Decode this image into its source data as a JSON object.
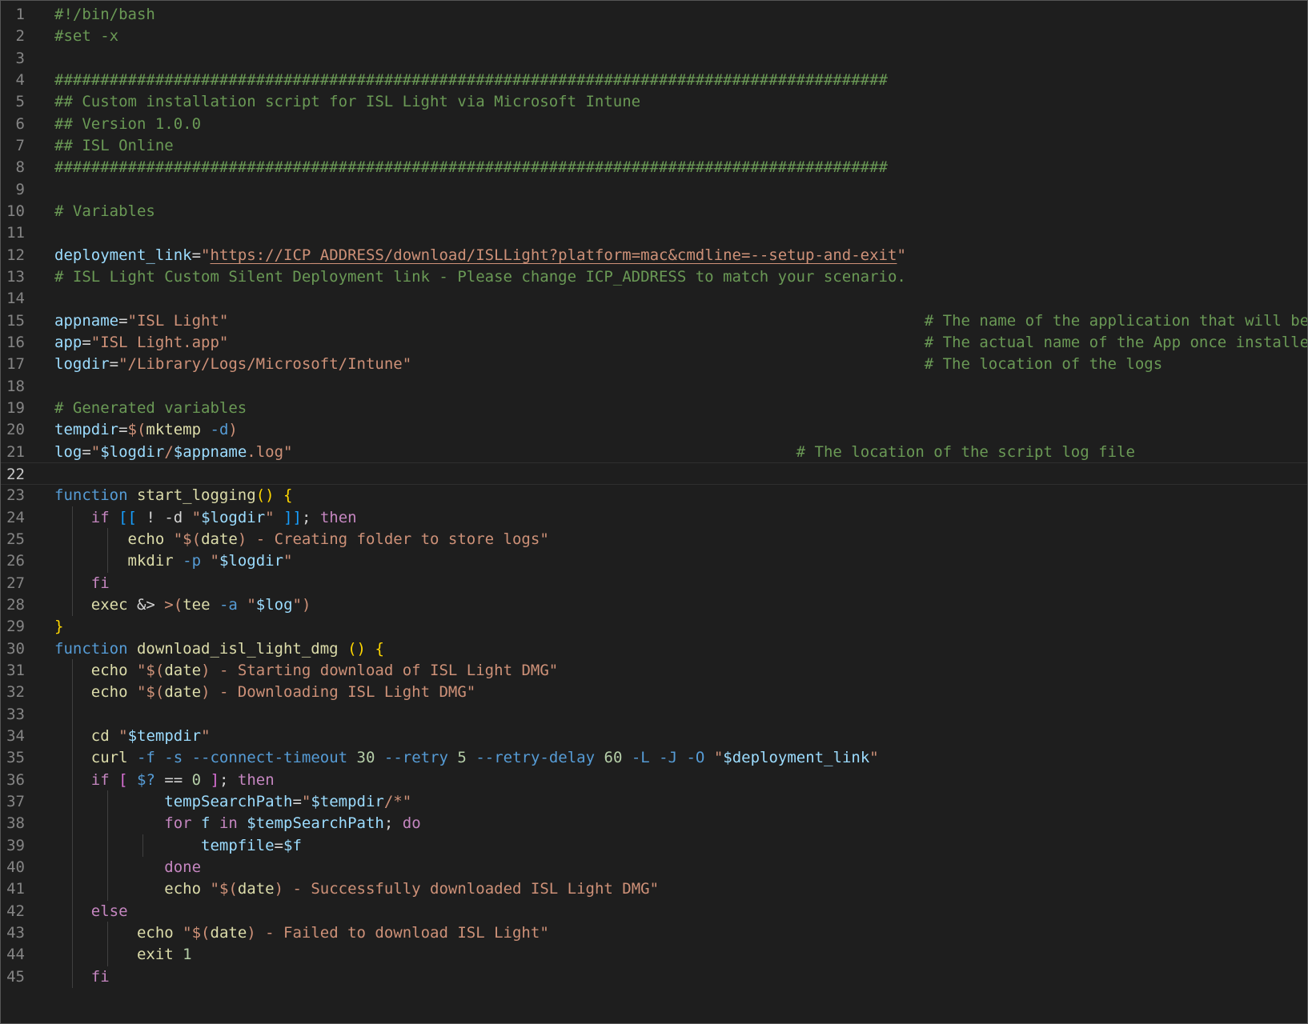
{
  "editor": {
    "language": "bash",
    "current_line": 22,
    "lines": [
      {
        "n": "1",
        "tokens": [
          {
            "t": "#!/bin/bash",
            "c": "cm"
          }
        ]
      },
      {
        "n": "2",
        "tokens": [
          {
            "t": "#set -x",
            "c": "cm"
          }
        ]
      },
      {
        "n": "3",
        "tokens": []
      },
      {
        "n": "4",
        "tokens": [
          {
            "t": "###########################################################################################",
            "c": "cm"
          }
        ]
      },
      {
        "n": "5",
        "tokens": [
          {
            "t": "## Custom installation script for ISL Light via Microsoft Intune",
            "c": "cm"
          }
        ]
      },
      {
        "n": "6",
        "tokens": [
          {
            "t": "## Version 1.0.0",
            "c": "cm"
          }
        ]
      },
      {
        "n": "7",
        "tokens": [
          {
            "t": "## ISL Online",
            "c": "cm"
          }
        ]
      },
      {
        "n": "8",
        "tokens": [
          {
            "t": "###########################################################################################",
            "c": "cm"
          }
        ]
      },
      {
        "n": "9",
        "tokens": []
      },
      {
        "n": "10",
        "tokens": [
          {
            "t": "# Variables",
            "c": "cm"
          }
        ]
      },
      {
        "n": "11",
        "tokens": []
      },
      {
        "n": "12",
        "tokens": [
          {
            "t": "deployment_link",
            "c": "vr"
          },
          {
            "t": "=",
            "c": "tx"
          },
          {
            "t": "\"",
            "c": "st"
          },
          {
            "t": "https://ICP_ADDRESS/download/ISLLight?platform=mac&cmdline=--setup-and-exit",
            "c": "st ul"
          },
          {
            "t": "\"",
            "c": "st"
          }
        ]
      },
      {
        "n": "13",
        "tokens": [
          {
            "t": "# ISL Light Custom Silent Deployment link - Please change ICP_ADDRESS to match your scenario.",
            "c": "cm"
          }
        ]
      },
      {
        "n": "14",
        "tokens": []
      },
      {
        "n": "15",
        "tokens": [
          {
            "t": "appname",
            "c": "vr"
          },
          {
            "t": "=",
            "c": "tx"
          },
          {
            "t": "\"ISL Light\"",
            "c": "st"
          },
          {
            "t": "                                                                            ",
            "c": "tx"
          },
          {
            "t": "# The name of the application that will be deployed",
            "c": "cm"
          }
        ]
      },
      {
        "n": "16",
        "tokens": [
          {
            "t": "app",
            "c": "vr"
          },
          {
            "t": "=",
            "c": "tx"
          },
          {
            "t": "\"ISL Light.app\"",
            "c": "st"
          },
          {
            "t": "                                                                            ",
            "c": "tx"
          },
          {
            "t": "# The actual name of the App once installed",
            "c": "cm"
          }
        ]
      },
      {
        "n": "17",
        "tokens": [
          {
            "t": "logdir",
            "c": "vr"
          },
          {
            "t": "=",
            "c": "tx"
          },
          {
            "t": "\"/Library/Logs/Microsoft/Intune\"",
            "c": "st"
          },
          {
            "t": "                                                        ",
            "c": "tx"
          },
          {
            "t": "# The location of the logs",
            "c": "cm"
          }
        ]
      },
      {
        "n": "18",
        "tokens": []
      },
      {
        "n": "19",
        "tokens": [
          {
            "t": "# Generated variables",
            "c": "cm"
          }
        ]
      },
      {
        "n": "20",
        "tokens": [
          {
            "t": "tempdir",
            "c": "vr"
          },
          {
            "t": "=",
            "c": "tx"
          },
          {
            "t": "$(",
            "c": "st"
          },
          {
            "t": "mktemp",
            "c": "fn"
          },
          {
            "t": " ",
            "c": "tx"
          },
          {
            "t": "-d",
            "c": "kw"
          },
          {
            "t": ")",
            "c": "st"
          }
        ]
      },
      {
        "n": "21",
        "tokens": [
          {
            "t": "log",
            "c": "vr"
          },
          {
            "t": "=",
            "c": "tx"
          },
          {
            "t": "\"",
            "c": "st"
          },
          {
            "t": "$logdir",
            "c": "vr"
          },
          {
            "t": "/",
            "c": "st"
          },
          {
            "t": "$appname",
            "c": "vr"
          },
          {
            "t": ".log\"",
            "c": "st"
          },
          {
            "t": "                                                       ",
            "c": "tx"
          },
          {
            "t": "# The location of the script log file",
            "c": "cm"
          }
        ]
      },
      {
        "n": "22",
        "tokens": []
      },
      {
        "n": "23",
        "tokens": [
          {
            "t": "function",
            "c": "kw"
          },
          {
            "t": " ",
            "c": "tx"
          },
          {
            "t": "start_logging",
            "c": "fn"
          },
          {
            "t": "()",
            "c": "br"
          },
          {
            "t": " ",
            "c": "tx"
          },
          {
            "t": "{",
            "c": "br"
          }
        ]
      },
      {
        "n": "24",
        "tokens": [
          {
            "t": "    ",
            "c": "tx"
          },
          {
            "t": "if",
            "c": "ct"
          },
          {
            "t": " ",
            "c": "tx"
          },
          {
            "t": "[[",
            "c": "bb"
          },
          {
            "t": " ! -d ",
            "c": "tx"
          },
          {
            "t": "\"",
            "c": "st"
          },
          {
            "t": "$logdir",
            "c": "vr"
          },
          {
            "t": "\"",
            "c": "st"
          },
          {
            "t": " ",
            "c": "tx"
          },
          {
            "t": "]]",
            "c": "bb"
          },
          {
            "t": "; ",
            "c": "tx"
          },
          {
            "t": "then",
            "c": "ct"
          }
        ]
      },
      {
        "n": "25",
        "tokens": [
          {
            "t": "        ",
            "c": "tx"
          },
          {
            "t": "echo",
            "c": "fn"
          },
          {
            "t": " ",
            "c": "tx"
          },
          {
            "t": "\"$(",
            "c": "st"
          },
          {
            "t": "date",
            "c": "fn"
          },
          {
            "t": ") - Creating folder to store logs\"",
            "c": "st"
          }
        ]
      },
      {
        "n": "26",
        "tokens": [
          {
            "t": "        ",
            "c": "tx"
          },
          {
            "t": "mkdir",
            "c": "fn"
          },
          {
            "t": " ",
            "c": "tx"
          },
          {
            "t": "-p",
            "c": "kw"
          },
          {
            "t": " ",
            "c": "tx"
          },
          {
            "t": "\"",
            "c": "st"
          },
          {
            "t": "$logdir",
            "c": "vr"
          },
          {
            "t": "\"",
            "c": "st"
          }
        ]
      },
      {
        "n": "27",
        "tokens": [
          {
            "t": "    ",
            "c": "tx"
          },
          {
            "t": "fi",
            "c": "ct"
          }
        ]
      },
      {
        "n": "28",
        "tokens": [
          {
            "t": "    ",
            "c": "tx"
          },
          {
            "t": "exec",
            "c": "fn"
          },
          {
            "t": " &> ",
            "c": "tx"
          },
          {
            "t": ">(",
            "c": "st"
          },
          {
            "t": "tee",
            "c": "fn"
          },
          {
            "t": " ",
            "c": "tx"
          },
          {
            "t": "-a",
            "c": "kw"
          },
          {
            "t": " ",
            "c": "tx"
          },
          {
            "t": "\"",
            "c": "st"
          },
          {
            "t": "$log",
            "c": "vr"
          },
          {
            "t": "\")",
            "c": "st"
          }
        ]
      },
      {
        "n": "29",
        "tokens": [
          {
            "t": "}",
            "c": "br"
          }
        ]
      },
      {
        "n": "30",
        "tokens": [
          {
            "t": "function",
            "c": "kw"
          },
          {
            "t": " ",
            "c": "tx"
          },
          {
            "t": "download_isl_light_dmg",
            "c": "fn"
          },
          {
            "t": " ",
            "c": "tx"
          },
          {
            "t": "()",
            "c": "br"
          },
          {
            "t": " ",
            "c": "tx"
          },
          {
            "t": "{",
            "c": "br"
          }
        ]
      },
      {
        "n": "31",
        "tokens": [
          {
            "t": "    ",
            "c": "tx"
          },
          {
            "t": "echo",
            "c": "fn"
          },
          {
            "t": " ",
            "c": "tx"
          },
          {
            "t": "\"$(",
            "c": "st"
          },
          {
            "t": "date",
            "c": "fn"
          },
          {
            "t": ") - Starting download of ISL Light DMG\"",
            "c": "st"
          }
        ]
      },
      {
        "n": "32",
        "tokens": [
          {
            "t": "    ",
            "c": "tx"
          },
          {
            "t": "echo",
            "c": "fn"
          },
          {
            "t": " ",
            "c": "tx"
          },
          {
            "t": "\"$(",
            "c": "st"
          },
          {
            "t": "date",
            "c": "fn"
          },
          {
            "t": ") - Downloading ISL Light DMG\"",
            "c": "st"
          }
        ]
      },
      {
        "n": "33",
        "tokens": []
      },
      {
        "n": "34",
        "tokens": [
          {
            "t": "    ",
            "c": "tx"
          },
          {
            "t": "cd",
            "c": "fn"
          },
          {
            "t": " ",
            "c": "tx"
          },
          {
            "t": "\"",
            "c": "st"
          },
          {
            "t": "$tempdir",
            "c": "vr"
          },
          {
            "t": "\"",
            "c": "st"
          }
        ]
      },
      {
        "n": "35",
        "tokens": [
          {
            "t": "    ",
            "c": "tx"
          },
          {
            "t": "curl",
            "c": "fn"
          },
          {
            "t": " ",
            "c": "tx"
          },
          {
            "t": "-f -s --connect-timeout",
            "c": "kw"
          },
          {
            "t": " ",
            "c": "tx"
          },
          {
            "t": "30",
            "c": "nm"
          },
          {
            "t": " ",
            "c": "tx"
          },
          {
            "t": "--retry",
            "c": "kw"
          },
          {
            "t": " ",
            "c": "tx"
          },
          {
            "t": "5",
            "c": "nm"
          },
          {
            "t": " ",
            "c": "tx"
          },
          {
            "t": "--retry-delay",
            "c": "kw"
          },
          {
            "t": " ",
            "c": "tx"
          },
          {
            "t": "60",
            "c": "nm"
          },
          {
            "t": " ",
            "c": "tx"
          },
          {
            "t": "-L -J -O",
            "c": "kw"
          },
          {
            "t": " ",
            "c": "tx"
          },
          {
            "t": "\"",
            "c": "st"
          },
          {
            "t": "$deployment_link",
            "c": "vr"
          },
          {
            "t": "\"",
            "c": "st"
          }
        ]
      },
      {
        "n": "36",
        "tokens": [
          {
            "t": "    ",
            "c": "tx"
          },
          {
            "t": "if",
            "c": "ct"
          },
          {
            "t": " ",
            "c": "tx"
          },
          {
            "t": "[",
            "c": "bp"
          },
          {
            "t": " ",
            "c": "tx"
          },
          {
            "t": "$?",
            "c": "kw"
          },
          {
            "t": " == ",
            "c": "tx"
          },
          {
            "t": "0",
            "c": "nm"
          },
          {
            "t": " ",
            "c": "tx"
          },
          {
            "t": "]",
            "c": "bp"
          },
          {
            "t": "; ",
            "c": "tx"
          },
          {
            "t": "then",
            "c": "ct"
          }
        ]
      },
      {
        "n": "37",
        "tokens": [
          {
            "t": "            ",
            "c": "tx"
          },
          {
            "t": "tempSearchPath",
            "c": "vr"
          },
          {
            "t": "=",
            "c": "tx"
          },
          {
            "t": "\"",
            "c": "st"
          },
          {
            "t": "$tempdir",
            "c": "vr"
          },
          {
            "t": "/*\"",
            "c": "st"
          }
        ]
      },
      {
        "n": "38",
        "tokens": [
          {
            "t": "            ",
            "c": "tx"
          },
          {
            "t": "for",
            "c": "ct"
          },
          {
            "t": " f ",
            "c": "vr"
          },
          {
            "t": "in",
            "c": "ct"
          },
          {
            "t": " ",
            "c": "tx"
          },
          {
            "t": "$tempSearchPath",
            "c": "vr"
          },
          {
            "t": "; ",
            "c": "tx"
          },
          {
            "t": "do",
            "c": "ct"
          }
        ]
      },
      {
        "n": "39",
        "tokens": [
          {
            "t": "                ",
            "c": "tx"
          },
          {
            "t": "tempfile",
            "c": "vr"
          },
          {
            "t": "=",
            "c": "tx"
          },
          {
            "t": "$f",
            "c": "vr"
          }
        ]
      },
      {
        "n": "40",
        "tokens": [
          {
            "t": "            ",
            "c": "tx"
          },
          {
            "t": "done",
            "c": "ct"
          }
        ]
      },
      {
        "n": "41",
        "tokens": [
          {
            "t": "            ",
            "c": "tx"
          },
          {
            "t": "echo",
            "c": "fn"
          },
          {
            "t": " ",
            "c": "tx"
          },
          {
            "t": "\"$(",
            "c": "st"
          },
          {
            "t": "date",
            "c": "fn"
          },
          {
            "t": ") - Successfully downloaded ISL Light DMG\"",
            "c": "st"
          }
        ]
      },
      {
        "n": "42",
        "tokens": [
          {
            "t": "    ",
            "c": "tx"
          },
          {
            "t": "else",
            "c": "ct"
          }
        ]
      },
      {
        "n": "43",
        "tokens": [
          {
            "t": "         ",
            "c": "tx"
          },
          {
            "t": "echo",
            "c": "fn"
          },
          {
            "t": " ",
            "c": "tx"
          },
          {
            "t": "\"$(",
            "c": "st"
          },
          {
            "t": "date",
            "c": "fn"
          },
          {
            "t": ") - Failed to download ISL Light\"",
            "c": "st"
          }
        ]
      },
      {
        "n": "44",
        "tokens": [
          {
            "t": "         ",
            "c": "tx"
          },
          {
            "t": "exit",
            "c": "fn"
          },
          {
            "t": " ",
            "c": "tx"
          },
          {
            "t": "1",
            "c": "nm"
          }
        ]
      },
      {
        "n": "45",
        "tokens": [
          {
            "t": "    ",
            "c": "tx"
          },
          {
            "t": "fi",
            "c": "ct"
          }
        ]
      }
    ]
  }
}
